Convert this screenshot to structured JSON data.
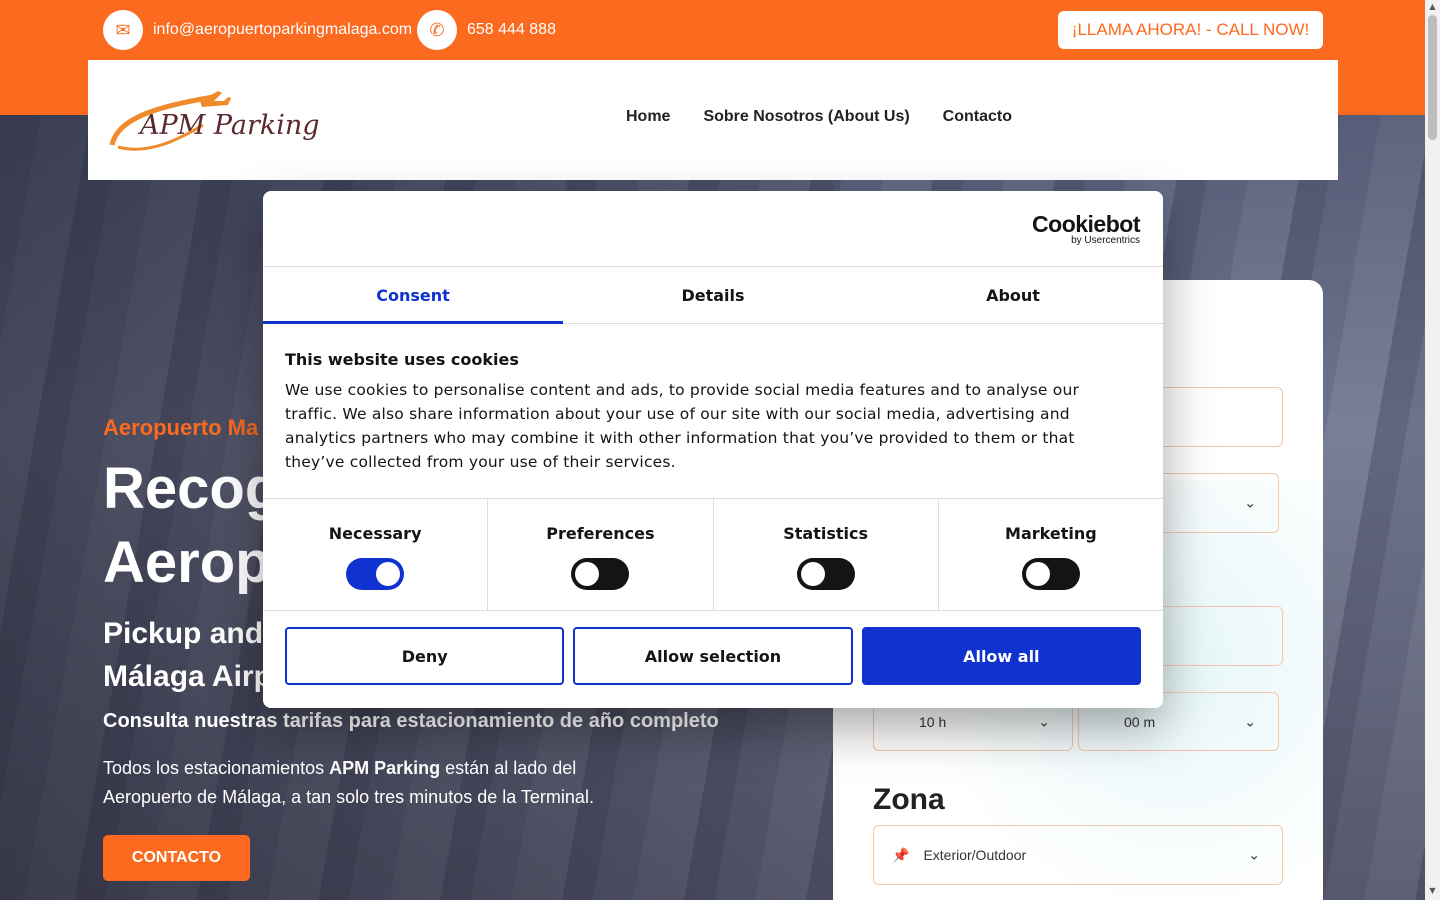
{
  "topbar": {
    "email": "info@aeropuertoparkingmalaga.com",
    "phone": "658 444 888",
    "call_label": "¡LLAMA AHORA! - CALL NOW!"
  },
  "brand": {
    "logo_text": "APM Parking"
  },
  "nav": [
    "Home",
    "Sobre Nosotros (About Us)",
    "Contacto"
  ],
  "hero": {
    "kicker": "Aeropuerto Ma",
    "title_line1": "Recog",
    "title_line2": "Aerop",
    "subtitle_line1": "Pickup and",
    "subtitle_line2": "Málaga Airp",
    "tariffs": "Consulta nuestras tarifas para estacionamiento de año completo",
    "para_pre": "Todos los estacionamientos ",
    "para_bold": "APM Parking",
    "para_post": " están al lado del Aeropuerto de Málaga, a tan solo tres minutos de la Terminal.",
    "cta": "CONTACTO"
  },
  "form": {
    "hour_value": "10 h",
    "minute_value": "00 m",
    "zona_label": "Zona",
    "zona_value": "Exterior/Outdoor"
  },
  "cookie": {
    "brand": "Cookiebot",
    "brand_sub": "by Usercentrics",
    "tabs": [
      "Consent",
      "Details",
      "About"
    ],
    "title": "This website uses cookies",
    "body": "We use cookies to personalise content and ads, to provide social media features and to analyse our traffic. We also share information about your use of our site with our social media, advertising and analytics partners who may combine it with other information that you’ve provided to them or that they’ve collected from your use of their services.",
    "toggles": [
      {
        "label": "Necessary",
        "on": true
      },
      {
        "label": "Preferences",
        "on": false
      },
      {
        "label": "Statistics",
        "on": false
      },
      {
        "label": "Marketing",
        "on": false
      }
    ],
    "deny": "Deny",
    "allow_selection": "Allow selection",
    "allow_all": "Allow all"
  },
  "colors": {
    "brand_orange": "#fb6a1f",
    "cookie_blue": "#1032cf"
  }
}
